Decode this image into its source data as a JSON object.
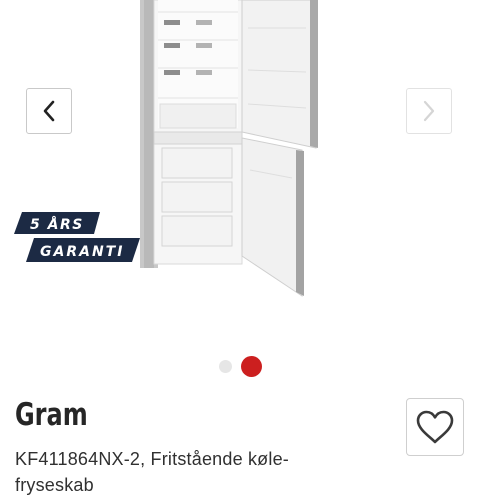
{
  "gallery": {
    "image_alt": "Gram KF411864NX-2 fridge-freezer",
    "prev_icon": "chevron-left-icon",
    "next_icon": "chevron-right-icon",
    "badge": {
      "line1": "5 ÅRS",
      "line2": "GARANTI",
      "color": "#1c2a44"
    },
    "dots": {
      "count": 2,
      "active_index": 2,
      "active_color": "#cc1f1f",
      "inactive_color": "#e6e6e6"
    }
  },
  "product": {
    "brand": "Gram",
    "name": "KF411864NX-2, Fritstående køle-fryseskab"
  },
  "favorite": {
    "icon": "heart-outline-icon"
  }
}
